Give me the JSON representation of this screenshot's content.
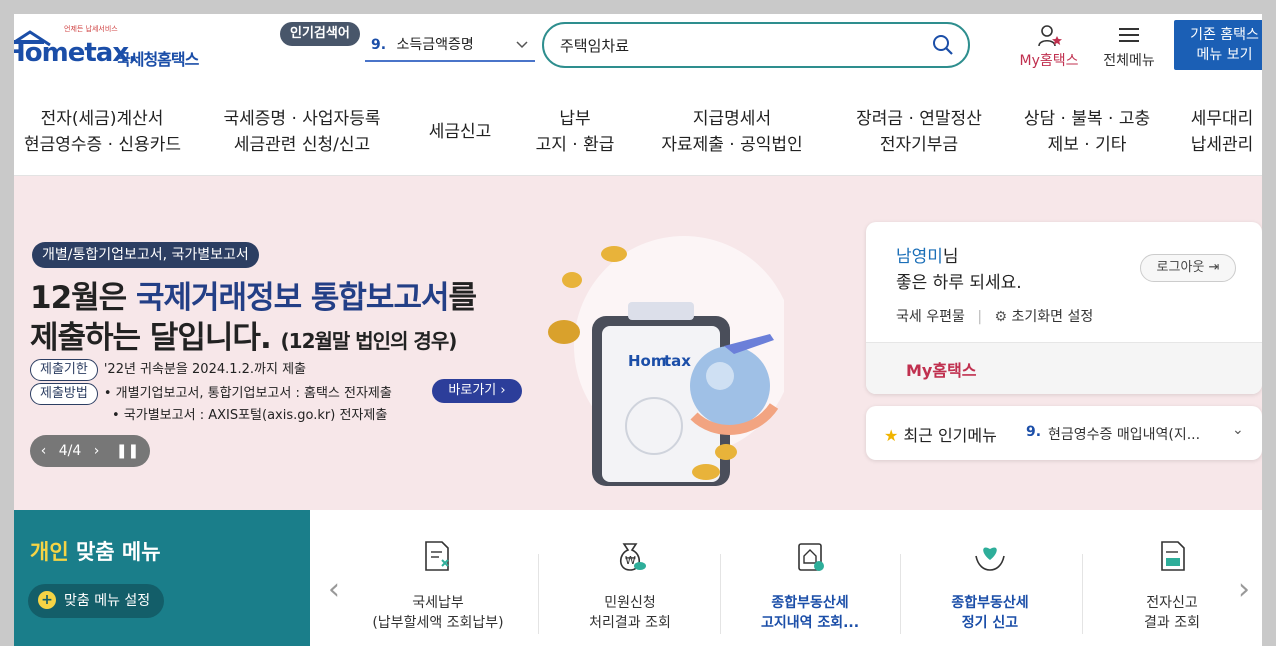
{
  "header": {
    "logo_text": "Hometax.",
    "logo_tagline": "언제든 납세서비스",
    "logo_korean": "국세청홈택스",
    "popular_label": "인기검색어",
    "popular_rank": "9.",
    "popular_term": "소득금액증명",
    "search_value": "주택임차료",
    "my_hometax": "My홈택스",
    "all_menu": "전체메뉴",
    "classic_line1": "기존 홈택스",
    "classic_line2": "메뉴 보기"
  },
  "nav": [
    {
      "line1": "전자(세금)계산서",
      "line2": "현금영수증 · 신용카드"
    },
    {
      "line1": "국세증명 · 사업자등록",
      "line2": "세금관련 신청/신고"
    },
    {
      "line1": "세금신고",
      "line2": ""
    },
    {
      "line1": "납부",
      "line2": "고지 · 환급"
    },
    {
      "line1": "지급명세서",
      "line2": "자료제출 · 공익법인"
    },
    {
      "line1": "장려금 · 연말정산",
      "line2": "전자기부금"
    },
    {
      "line1": "상담 · 불복 · 고충",
      "line2": "제보 · 기타"
    },
    {
      "line1": "세무대리",
      "line2": "납세관리"
    }
  ],
  "hero": {
    "tag": "개별/통합기업보고서, 국가별보고서",
    "title1_prefix": "12월은 ",
    "title1_highlight": "국제거래정보 통합보고서",
    "title1_suffix": "를",
    "title2_main": "제출하는 달입니다. ",
    "title2_small": "(12월말 법인의 경우)",
    "deadline_label": "제출기한",
    "deadline_text": "'22년 귀속분을 2024.1.2.까지 제출",
    "method_label": "제출방법",
    "method_text1": "• 개별기업보고서, 통합기업보고서 : 홈택스 전자제출",
    "method_text2": "• 국가별보고서 : AXIS포털(axis.go.kr) 전자제출",
    "goto_label": "바로가기",
    "pager": "4/4"
  },
  "login": {
    "name": "남영미",
    "name_suffix": "님",
    "greeting": "좋은 하루 되세요.",
    "logout": "로그아웃",
    "mailbox": "국세 우편물",
    "home_setting": "초기화면 설정",
    "my_hometax": "My홈택스"
  },
  "recent": {
    "title": "최근 인기메뉴",
    "rank": "9.",
    "value": "현금영수증 매입내역(지..."
  },
  "personal": {
    "title_highlight": "개인",
    "title_rest": " 맞춤 메뉴",
    "setting": "맞춤 메뉴 설정"
  },
  "quick_menu": [
    {
      "line1": "국세납부",
      "line2": "(납부할세액 조회납부)",
      "icon": "tax-payment-icon",
      "highlight": false
    },
    {
      "line1": "민원신청",
      "line2": "처리결과 조회",
      "icon": "money-bag-icon",
      "highlight": false
    },
    {
      "line1": "종합부동산세",
      "line2": "고지내역 조회...",
      "icon": "property-notice-icon",
      "highlight": true
    },
    {
      "line1": "종합부동산세",
      "line2": "정기 신고",
      "icon": "heart-hand-icon",
      "highlight": true
    },
    {
      "line1": "전자신고",
      "line2": "결과 조회",
      "icon": "document-result-icon",
      "highlight": false
    }
  ],
  "colors": {
    "brand_blue": "#1b4ea8",
    "teal": "#1a7e8a",
    "accent_red": "#c0304f",
    "hero_bg": "#f7e7e9"
  }
}
